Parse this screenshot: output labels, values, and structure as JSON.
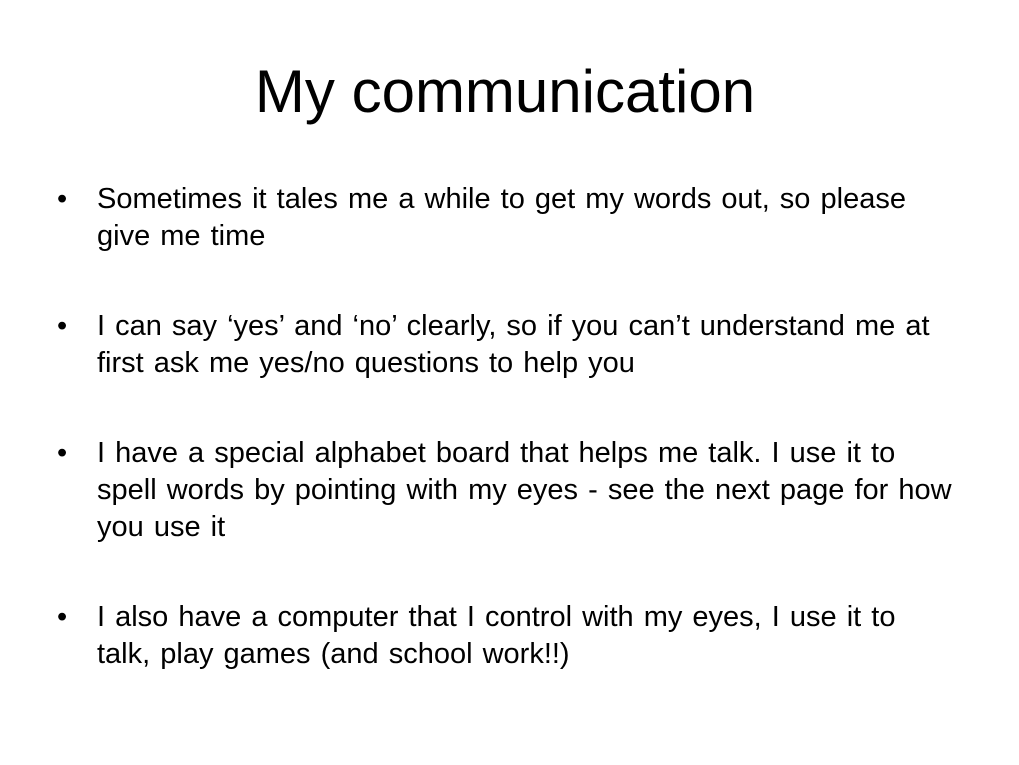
{
  "slide": {
    "title": "My communication",
    "bullet_glyph": "•",
    "bullets": [
      {
        "text": "Sometimes it tales me a while to get my words out, so please give me time"
      },
      {
        "text": "I can say ‘yes’ and ‘no’ clearly, so if you can’t understand me at first ask me yes/no questions to help you"
      },
      {
        "text": "I have a special alphabet board that helps me talk. I use it to spell words by pointing with my eyes -  see the next page for how you use it"
      },
      {
        "text": "I also have a computer that I control with my eyes, I use it to talk, play games (and school work!!)"
      }
    ]
  }
}
